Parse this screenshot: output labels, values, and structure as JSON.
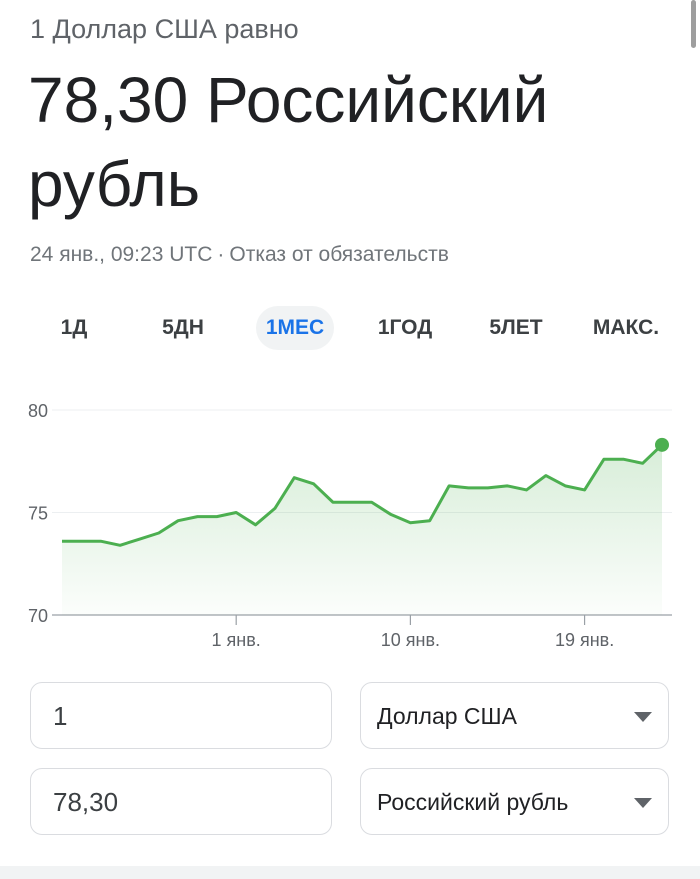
{
  "header": {
    "subtitle": "1 Доллар США равно",
    "result": "78,30 Российский рубль",
    "timestamp": "24 янв., 09:23 UTC",
    "separator": "·",
    "disclaimer": "Отказ от обязательств"
  },
  "tabs": [
    {
      "label": "1Д",
      "active": false
    },
    {
      "label": "5ДН",
      "active": false
    },
    {
      "label": "1МЕС",
      "active": true
    },
    {
      "label": "1ГОД",
      "active": false
    },
    {
      "label": "5ЛЕТ",
      "active": false
    },
    {
      "label": "МАКС.",
      "active": false
    }
  ],
  "colors": {
    "line": "#4caf50",
    "fill": "#e8f5e9",
    "active_tab": "#1a73e8"
  },
  "chart_data": {
    "type": "area",
    "ylim": [
      70,
      80
    ],
    "y_ticks": [
      "80",
      "75",
      "70"
    ],
    "x_ticks": [
      "1 янв.",
      "10 янв.",
      "19 янв."
    ],
    "x_tick_positions": [
      9,
      18,
      27
    ],
    "series": [
      {
        "values": [
          73.6,
          73.6,
          73.6,
          73.4,
          73.7,
          74.0,
          74.6,
          74.8,
          74.8,
          75.0,
          74.4,
          75.2,
          76.7,
          76.4,
          75.5,
          75.5,
          75.5,
          74.9,
          74.5,
          74.6,
          76.3,
          76.2,
          76.2,
          76.3,
          76.1,
          76.8,
          76.3,
          76.1,
          77.6,
          77.6,
          77.4,
          78.3
        ]
      }
    ]
  },
  "converter": {
    "from_amount": "1",
    "from_currency": "Доллар США",
    "to_amount": "78,30",
    "to_currency": "Российский рубль"
  }
}
